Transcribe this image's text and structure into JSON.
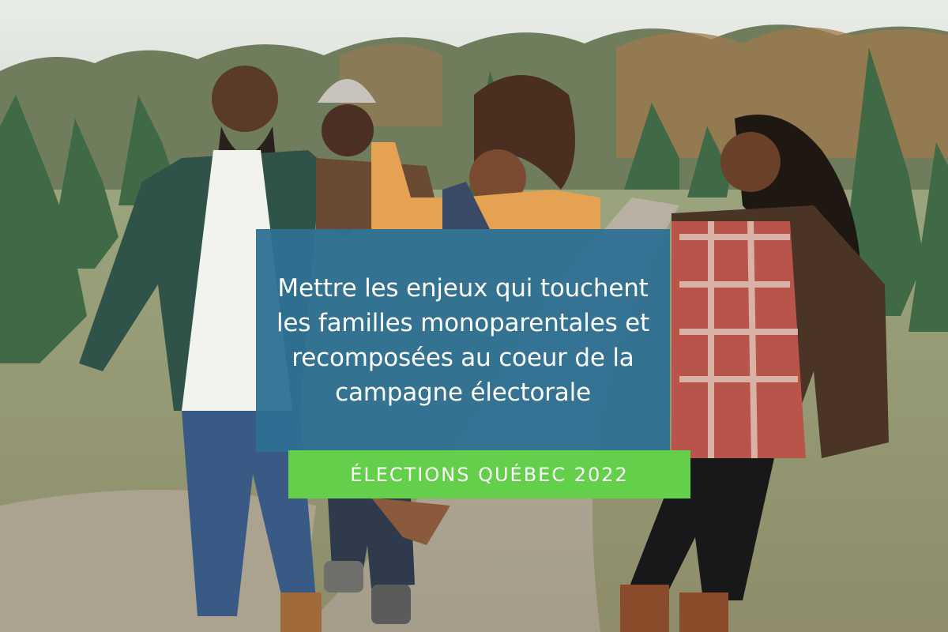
{
  "photo": {
    "subject": "family-walking-on-path-among-christmas-trees"
  },
  "overlay": {
    "headline": "Mettre les enjeux qui touchent les familles monoparentales et recomposées au coeur de la campagne électorale",
    "badge_label": "ÉLECTIONS QUÉBEC 2022",
    "box_color": "#2e7094",
    "badge_color": "#63cf4a"
  }
}
